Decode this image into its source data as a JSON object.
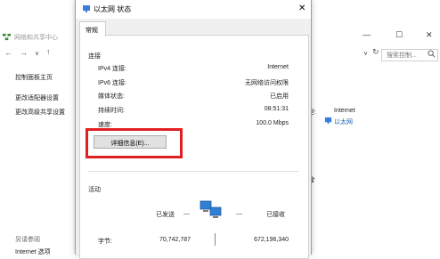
{
  "background_window": {
    "title": "网络和共享中心",
    "search_placeholder": "搜索控制...",
    "sidebar_links": [
      "控制面板主页",
      "更改适配器设置",
      "更改高级共享设置"
    ],
    "access_type_label_partial": "型:",
    "access_type_value": "Internet",
    "connection_link": "以太网",
    "see_also_heading": "另请参阅",
    "see_also_item": "Internet 选项"
  },
  "dialog": {
    "title": "以太网 状态",
    "tab": "常规",
    "connection_group": "连接",
    "rows": [
      {
        "label": "IPv4 连接:",
        "value": "Internet"
      },
      {
        "label": "IPv6 连接:",
        "value": "无网络访问权限"
      },
      {
        "label": "媒体状态:",
        "value": "已启用"
      },
      {
        "label": "持续时间:",
        "value": "08:51:31"
      },
      {
        "label": "速度:",
        "value": "100.0 Mbps"
      }
    ],
    "details_button": "详细信息(E)...",
    "activity_group": "活动",
    "sent_label": "已发送",
    "received_label": "已接收",
    "dash_left": "—",
    "dash_right": "—",
    "bytes_label": "字节:",
    "bytes_sent": "70,742,787",
    "bytes_received": "672,196,340"
  },
  "colors": {
    "highlight": "#e02020",
    "link": "#1a5fb4"
  },
  "icons": [
    "network-center-icon",
    "back-arrow-icon",
    "forward-arrow-icon",
    "search-icon",
    "ethernet-icon",
    "network-computers-icon",
    "close-icon"
  ]
}
